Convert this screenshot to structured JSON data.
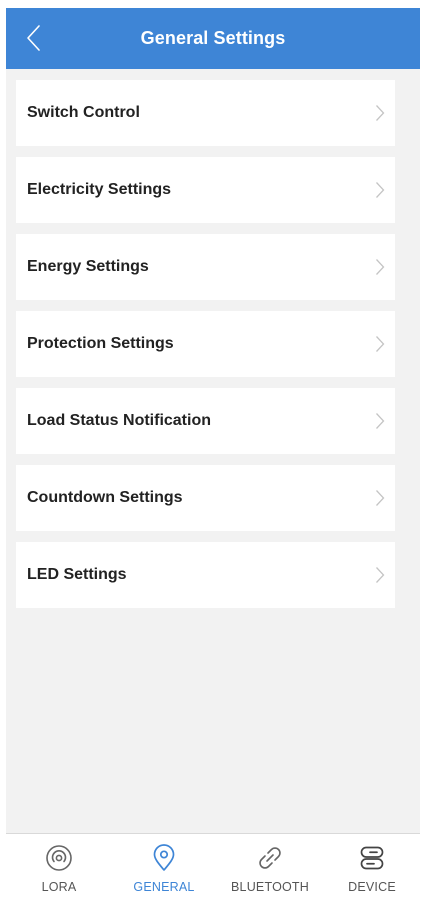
{
  "header": {
    "title": "General Settings",
    "back_icon": "chevron-left-icon"
  },
  "menu": {
    "items": [
      {
        "label": "Switch Control"
      },
      {
        "label": "Electricity Settings"
      },
      {
        "label": "Energy Settings"
      },
      {
        "label": "Protection Settings"
      },
      {
        "label": "Load Status Notification"
      },
      {
        "label": "Countdown Settings"
      },
      {
        "label": "LED Settings"
      }
    ],
    "chevron_icon": "chevron-right-icon"
  },
  "tabbar": {
    "tabs": [
      {
        "label": "LORA",
        "icon": "lora-signal-icon",
        "active": false
      },
      {
        "label": "GENERAL",
        "icon": "location-pin-icon",
        "active": true
      },
      {
        "label": "BLUETOOTH",
        "icon": "link-icon",
        "active": false
      },
      {
        "label": "DEVICE",
        "icon": "device-toggle-icon",
        "active": false
      }
    ]
  },
  "colors": {
    "header_bg": "#3e85d6",
    "accent": "#3e85d6",
    "page_bg": "#f2f2f2",
    "inactive_tab": "#555555"
  }
}
